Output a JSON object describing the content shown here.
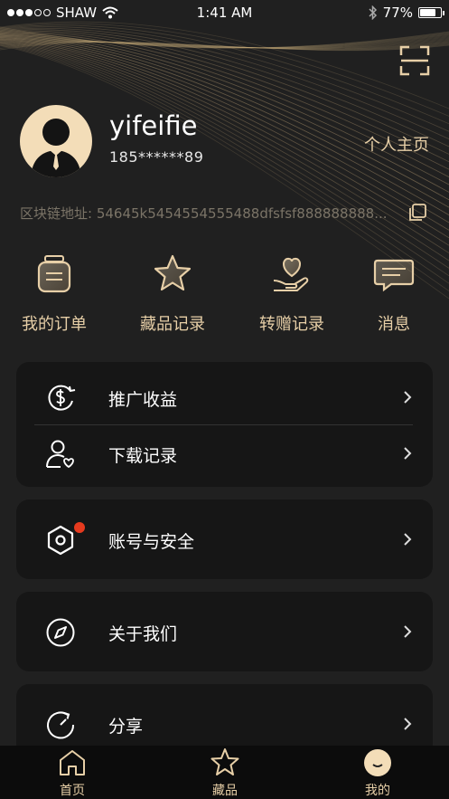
{
  "status_bar": {
    "carrier": "SHAW",
    "time": "1:41 AM",
    "battery": "77%",
    "battery_level": 0.77
  },
  "profile": {
    "username": "yifeifie",
    "phone": "185******89",
    "homepage_link": "个人主页"
  },
  "blockchain": {
    "label": "区块链地址:",
    "address": "54645k5454554555488dfsfsf888888888..."
  },
  "quick_actions": [
    {
      "label": "我的订单",
      "icon": "order-jar-icon"
    },
    {
      "label": "藏品记录",
      "icon": "star-icon"
    },
    {
      "label": "转赠记录",
      "icon": "gift-heart-hand-icon"
    },
    {
      "label": "消息",
      "icon": "message-icon"
    }
  ],
  "menu": {
    "promotion": "推广收益",
    "downloads": "下载记录",
    "security": "账号与安全",
    "about": "关于我们",
    "share": "分享"
  },
  "tabs": [
    {
      "label": "首页",
      "icon": "home-icon"
    },
    {
      "label": "藏品",
      "icon": "star-icon"
    },
    {
      "label": "我的",
      "icon": "smile-icon"
    }
  ],
  "colors": {
    "accent": "#e7cfa7",
    "background": "#202020",
    "card": "#161616",
    "badge": "#e63a1e"
  }
}
